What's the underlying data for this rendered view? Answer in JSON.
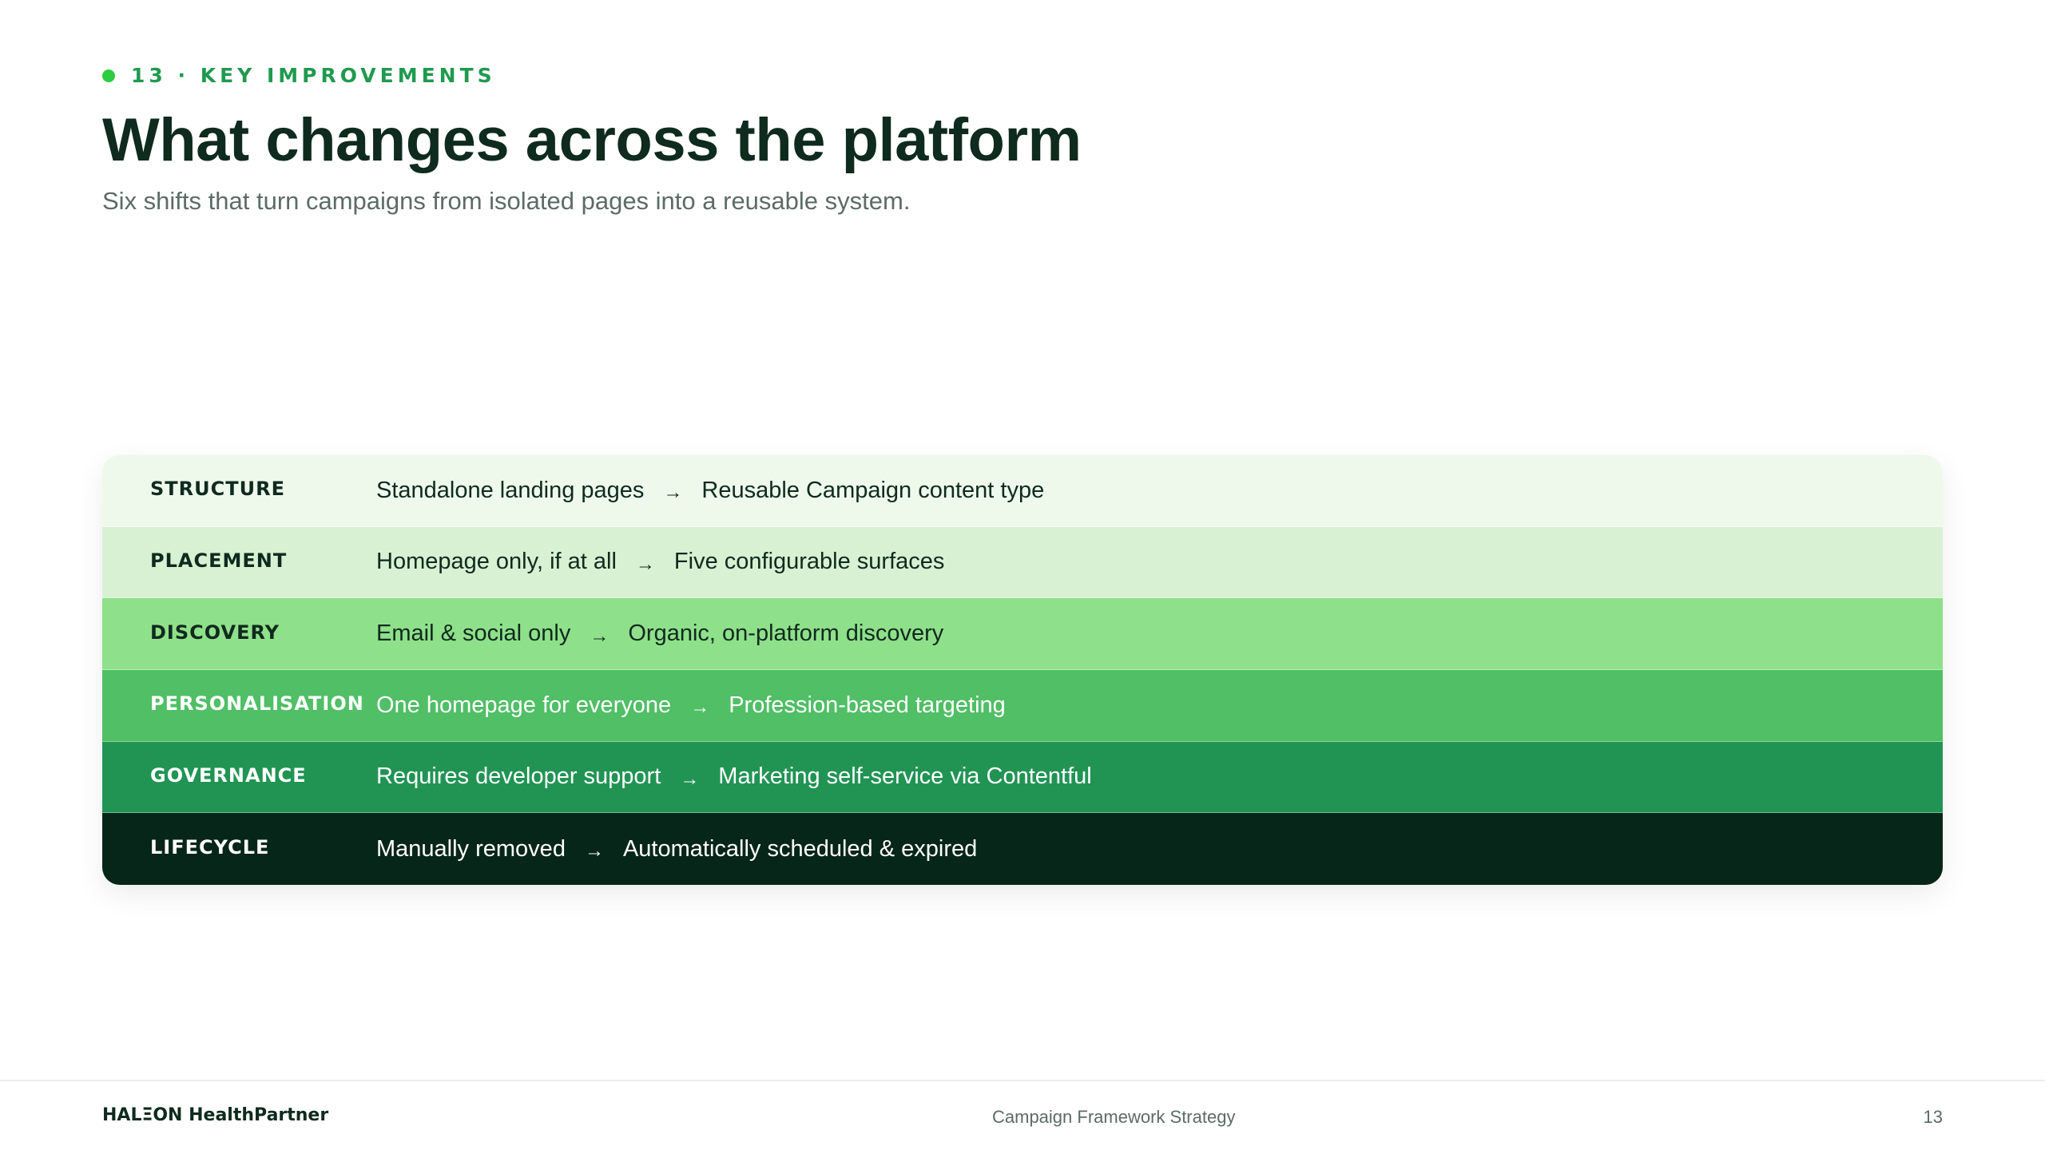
{
  "slide": {
    "eyebrow": "13 · KEY IMPROVEMENTS",
    "title": "What changes across the platform",
    "subtitle": "Six shifts that turn campaigns from isolated pages into a reusable system."
  },
  "improvements": [
    {
      "label": "STRUCTURE",
      "from": "Standalone landing pages",
      "arrow": "→",
      "to": "Reusable Campaign content type",
      "bg": "#eef9ec",
      "text": "#0f2a1e"
    },
    {
      "label": "PLACEMENT",
      "from": "Homepage only, if at all",
      "arrow": "→",
      "to": "Five configurable surfaces",
      "bg": "#d8f1d3",
      "text": "#0f2a1e"
    },
    {
      "label": "DISCOVERY",
      "from": "Email & social only",
      "arrow": "→",
      "to": "Organic, on-platform discovery",
      "bg": "#8fe08a",
      "text": "#0f2a1e"
    },
    {
      "label": "PERSONALISATION",
      "from": "One homepage for everyone",
      "arrow": "→",
      "to": "Profession-based targeting",
      "bg": "#50bf66",
      "text": "#ffffff"
    },
    {
      "label": "GOVERNANCE",
      "from": "Requires developer support",
      "arrow": "→",
      "to": "Marketing self-service via Contentful",
      "bg": "#219454",
      "text": "#ffffff"
    },
    {
      "label": "LIFECYCLE",
      "from": "Manually removed",
      "arrow": "→",
      "to": "Automatically scheduled & expired",
      "bg": "#07261a",
      "text": "#ffffff"
    }
  ],
  "footer": {
    "brand": "HALΞON HealthPartner",
    "center": "Campaign Framework Strategy",
    "page": "13"
  },
  "colors": {
    "accent_dot": "#2ecc40",
    "eyebrow": "#1f9a4f",
    "title": "#0f2a1e"
  }
}
